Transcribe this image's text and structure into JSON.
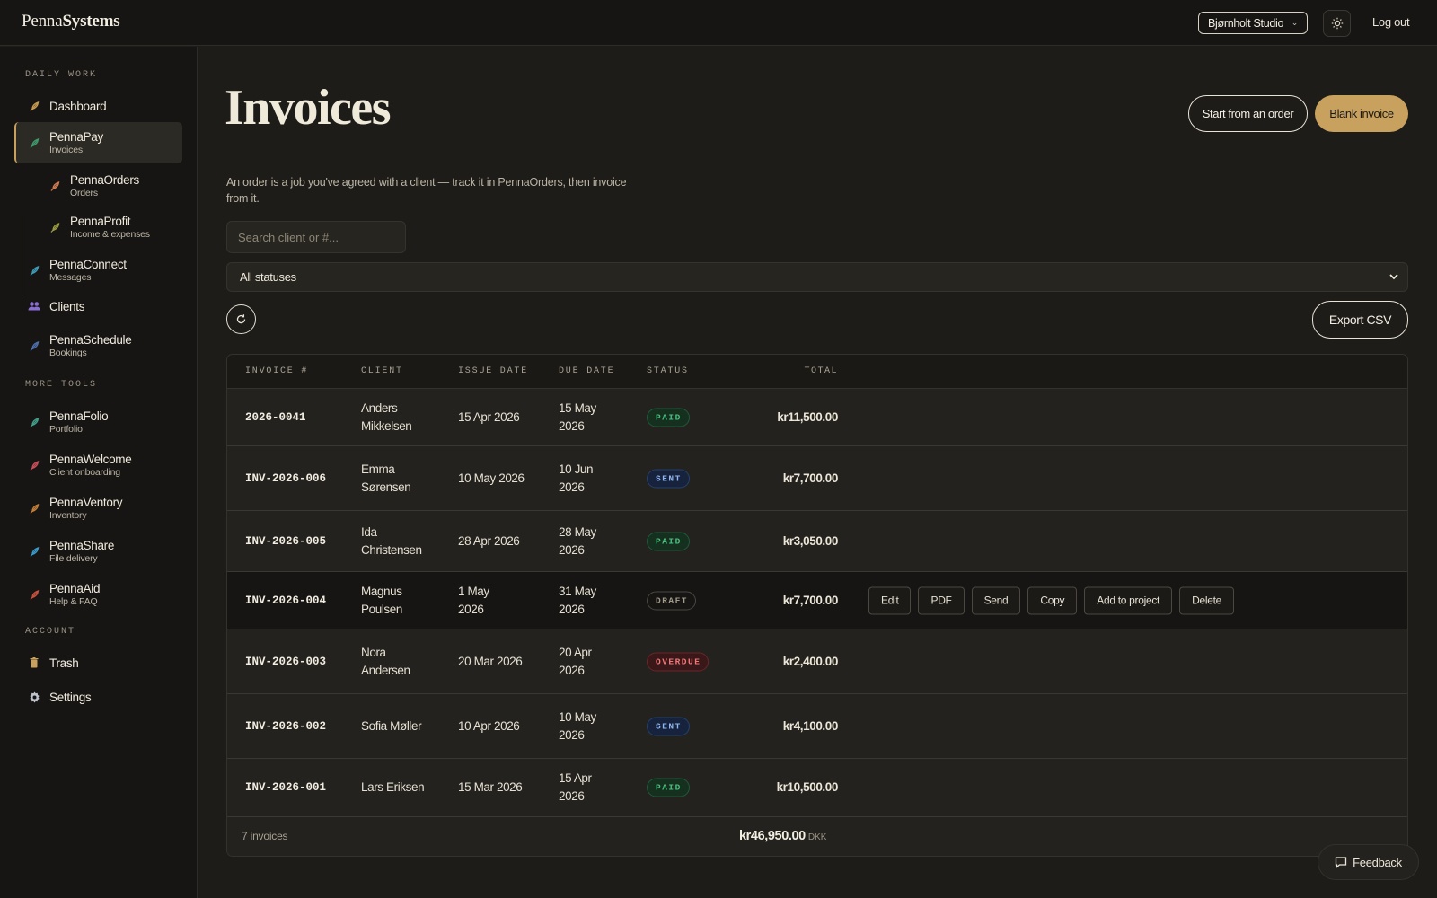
{
  "brand": {
    "first": "Penna",
    "second": "Systems"
  },
  "topbar": {
    "workspace": "Bjørnholt Studio",
    "theme_icon": "sun-icon",
    "logout": "Log out"
  },
  "sidebar": {
    "sections": [
      {
        "title": "DAILY WORK",
        "items": [
          {
            "label": "Dashboard",
            "sub": "",
            "icon": "feather-icon",
            "color": "#c89a4e"
          },
          {
            "label": "PennaPay",
            "sub": "Invoices",
            "icon": "feather-icon",
            "color": "#3f9a6a",
            "active": true
          },
          {
            "label": "PennaOrders",
            "sub": "Orders",
            "icon": "feather-icon",
            "color": "#d07a52",
            "child": true
          },
          {
            "label": "PennaProfit",
            "sub": "Income & expenses",
            "icon": "feather-icon",
            "color": "#9a9a45",
            "child": true
          },
          {
            "label": "PennaConnect",
            "sub": "Messages",
            "icon": "feather-icon",
            "color": "#3e9ab8"
          },
          {
            "label": "Clients",
            "sub": "",
            "icon": "users-icon",
            "color": "#8a6fd0"
          },
          {
            "label": "PennaSchedule",
            "sub": "Bookings",
            "icon": "feather-icon",
            "color": "#4f6fb0"
          }
        ]
      },
      {
        "title": "MORE TOOLS",
        "items": [
          {
            "label": "PennaFolio",
            "sub": "Portfolio",
            "icon": "feather-icon",
            "color": "#3fa08a"
          },
          {
            "label": "PennaWelcome",
            "sub": "Client onboarding",
            "icon": "feather-icon",
            "color": "#c84e5a"
          },
          {
            "label": "PennaVentory",
            "sub": "Inventory",
            "icon": "feather-icon",
            "color": "#c27e3a"
          },
          {
            "label": "PennaShare",
            "sub": "File delivery",
            "icon": "feather-icon",
            "color": "#3a9ac8"
          },
          {
            "label": "PennaAid",
            "sub": "Help & FAQ",
            "icon": "feather-icon",
            "color": "#c8503e"
          }
        ]
      },
      {
        "title": "ACCOUNT",
        "items": [
          {
            "label": "Trash",
            "sub": "",
            "icon": "trash-icon",
            "color": "#c9a15e"
          },
          {
            "label": "Settings",
            "sub": "",
            "icon": "gear-icon",
            "color": "#bfc4cc"
          }
        ]
      }
    ]
  },
  "page": {
    "title": "Invoices",
    "intro": "An order is a job you've agreed with a client — track it in PennaOrders, then invoice from it.",
    "btn_from_order": "Start from an order",
    "btn_blank": "Blank invoice",
    "search_placeholder": "Search client or #...",
    "status_filter": "All statuses",
    "export": "Export CSV"
  },
  "table": {
    "columns": [
      "INVOICE #",
      "CLIENT",
      "ISSUE DATE",
      "DUE DATE",
      "STATUS",
      "TOTAL"
    ],
    "rows": [
      {
        "number": "2026-0041",
        "client": "Anders Mikkelsen",
        "issue": "15 Apr 2026",
        "due": "15 May 2026",
        "status": "PAID",
        "status_kind": "paid",
        "total": "kr11,500.00"
      },
      {
        "number": "INV-2026-006",
        "client": "Emma Sørensen",
        "issue": "10 May 2026",
        "due": "10 Jun 2026",
        "status": "SENT",
        "status_kind": "sent",
        "total": "kr7,700.00"
      },
      {
        "number": "INV-2026-005",
        "client": "Ida Christensen",
        "issue": "28 Apr 2026",
        "due": "28 May 2026",
        "status": "PAID",
        "status_kind": "paid",
        "total": "kr3,050.00"
      },
      {
        "number": "INV-2026-004",
        "client": "Magnus Poulsen",
        "issue": "1 May 2026",
        "due": "31 May 2026",
        "status": "DRAFT",
        "status_kind": "draft",
        "total": "kr7,700.00",
        "hovered": true
      },
      {
        "number": "INV-2026-003",
        "client": "Nora Andersen",
        "issue": "20 Mar 2026",
        "due": "20 Apr 2026",
        "status": "OVERDUE",
        "status_kind": "overdue",
        "total": "kr2,400.00"
      },
      {
        "number": "INV-2026-002",
        "client": "Sofia Møller",
        "issue": "10 Apr 2026",
        "due": "10 May 2026",
        "status": "SENT",
        "status_kind": "sent",
        "total": "kr4,100.00"
      },
      {
        "number": "INV-2026-001",
        "client": "Lars Eriksen",
        "issue": "15 Mar 2026",
        "due": "15 Apr 2026",
        "status": "PAID",
        "status_kind": "paid",
        "total": "kr10,500.00"
      }
    ],
    "row_actions": [
      "Edit",
      "PDF",
      "Send",
      "Copy",
      "Add to project",
      "Delete"
    ],
    "footer": {
      "count": "7 invoices",
      "total": "kr46,950.00",
      "currency": "DKK"
    }
  },
  "feedback": "Feedback"
}
